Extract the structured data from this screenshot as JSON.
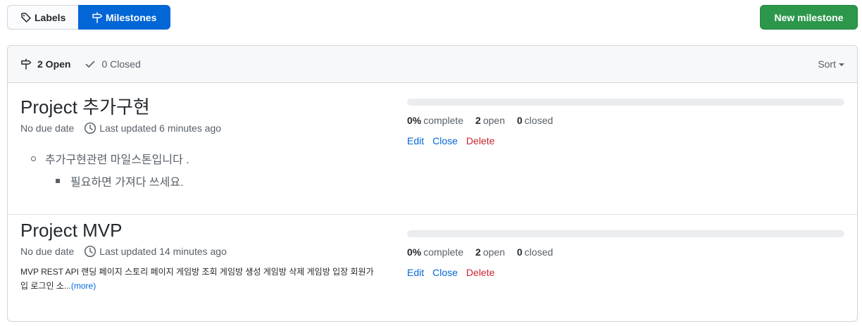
{
  "subnav": {
    "labels_label": "Labels",
    "milestones_label": "Milestones"
  },
  "new_milestone_label": "New milestone",
  "header": {
    "open_label": "2 Open",
    "closed_label": "0 Closed",
    "sort_label": "Sort"
  },
  "milestones": [
    {
      "title": "Project 추가구현",
      "due": "No due date",
      "updated": "Last updated 6 minutes ago",
      "description_items": [
        "추가구현관련 마일스톤입니다 .",
        "필요하면 가져다 쓰세요."
      ],
      "progress": 0,
      "percent_value": "0%",
      "percent_label": "complete",
      "open_value": "2",
      "open_label": "open",
      "closed_value": "0",
      "closed_label": "closed",
      "edit_label": "Edit",
      "close_label": "Close",
      "delete_label": "Delete"
    },
    {
      "title": "Project MVP",
      "due": "No due date",
      "updated": "Last updated 14 minutes ago",
      "description": "MVP REST API 랜딩 페이지 스토리 페이지 게임방 조회 게임방 생성 게임방 삭제 게임방 입장 회원가입 로그인 소...",
      "more_label": "(more)",
      "progress": 0,
      "percent_value": "0%",
      "percent_label": "complete",
      "open_value": "2",
      "open_label": "open",
      "closed_value": "0",
      "closed_label": "closed",
      "edit_label": "Edit",
      "close_label": "Close",
      "delete_label": "Delete"
    }
  ],
  "colors": {
    "accent": "#0366d6",
    "primary_button": "#2c974b",
    "danger": "#cb2431"
  },
  "icons": [
    "tag-icon",
    "milestone-icon",
    "check-icon",
    "clock-icon",
    "caret-down-icon"
  ]
}
